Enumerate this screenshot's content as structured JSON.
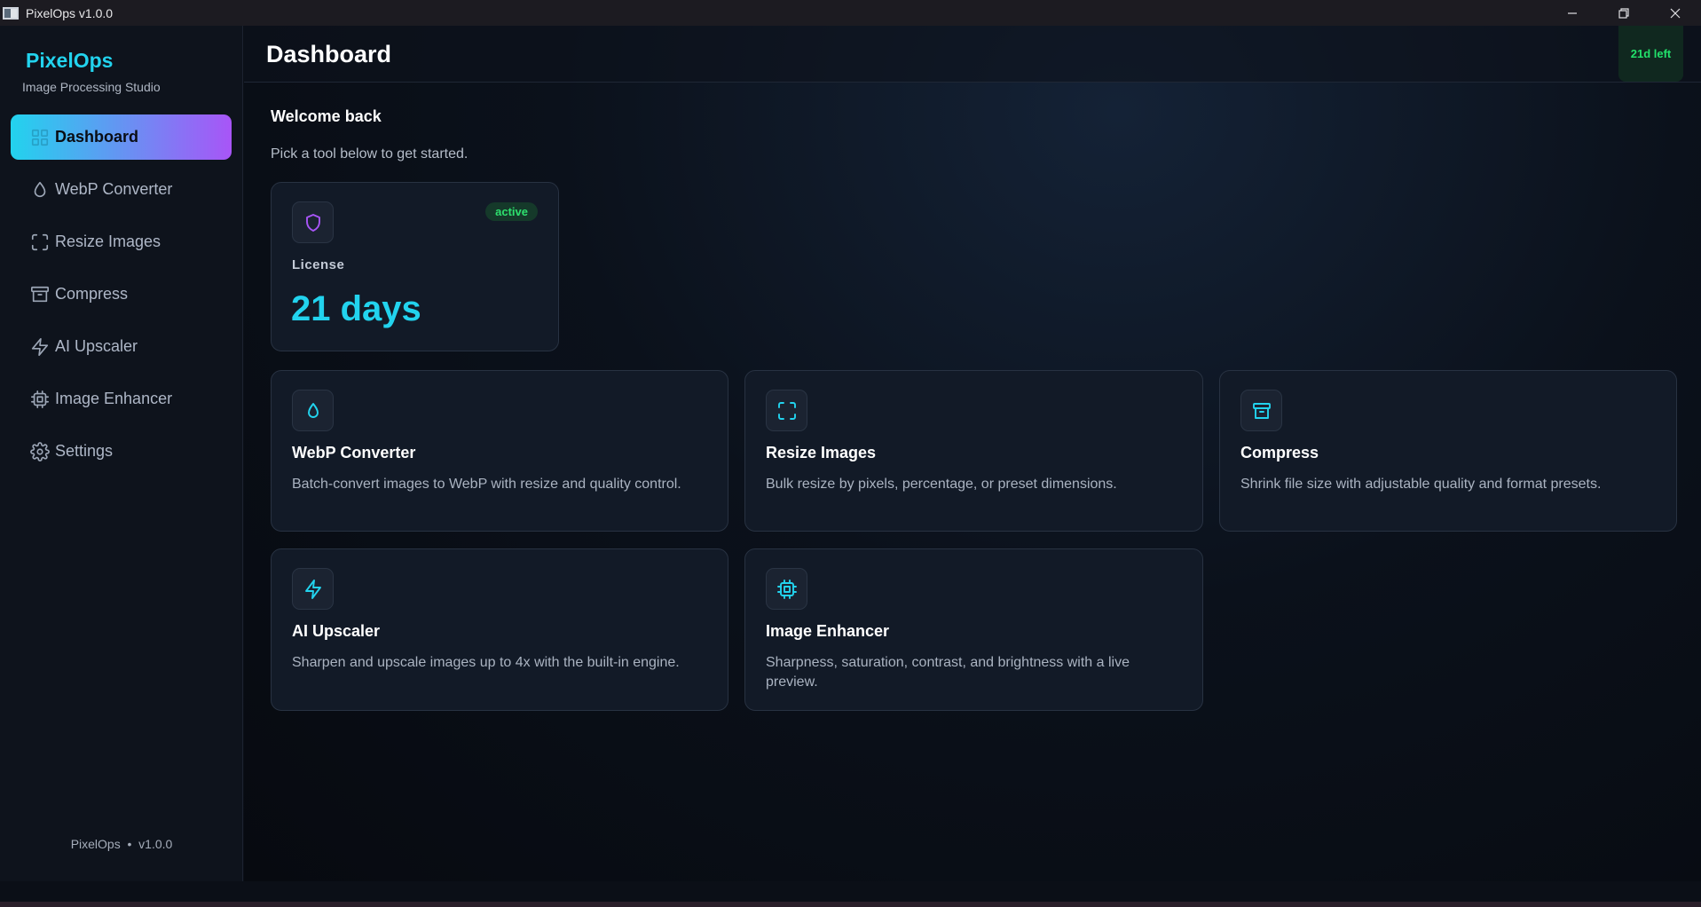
{
  "window": {
    "title": "PixelOps v1.0.0"
  },
  "sidebar": {
    "brand": "PixelOps",
    "brand_sub": "Image Processing Studio",
    "items": [
      {
        "label": "Dashboard",
        "icon": "grid-icon",
        "active": true
      },
      {
        "label": "WebP Converter",
        "icon": "droplet-icon",
        "active": false
      },
      {
        "label": "Resize Images",
        "icon": "scan-icon",
        "active": false
      },
      {
        "label": "Compress",
        "icon": "archive-icon",
        "active": false
      },
      {
        "label": "AI Upscaler",
        "icon": "zap-icon",
        "active": false
      },
      {
        "label": "Image Enhancer",
        "icon": "cpu-icon",
        "active": false
      },
      {
        "label": "Settings",
        "icon": "gear-icon",
        "active": false
      }
    ],
    "footer": "PixelOps  •  v1.0.0"
  },
  "header": {
    "title": "Dashboard",
    "days_badge": "21d left"
  },
  "main": {
    "welcome": "Welcome back",
    "subtitle": "Pick a tool below to get started.",
    "license": {
      "label": "License",
      "days": "21 days",
      "status": "active"
    },
    "tools": [
      {
        "title": "WebP Converter",
        "desc": "Batch-convert images to WebP with resize and quality control.",
        "icon": "droplet-icon"
      },
      {
        "title": "Resize Images",
        "desc": "Bulk resize by pixels, percentage, or preset dimensions.",
        "icon": "scan-icon"
      },
      {
        "title": "Compress",
        "desc": "Shrink file size with adjustable quality and format presets.",
        "icon": "archive-icon"
      },
      {
        "title": "AI Upscaler",
        "desc": "Sharpen and upscale images up to 4x with the built-in engine.",
        "icon": "zap-icon"
      },
      {
        "title": "Image Enhancer",
        "desc": "Sharpness, saturation, contrast, and brightness with a live preview.",
        "icon": "cpu-icon"
      }
    ]
  },
  "colors": {
    "accent": "#22d3ee",
    "accent_2": "#a855f7",
    "success": "#22e06a"
  }
}
